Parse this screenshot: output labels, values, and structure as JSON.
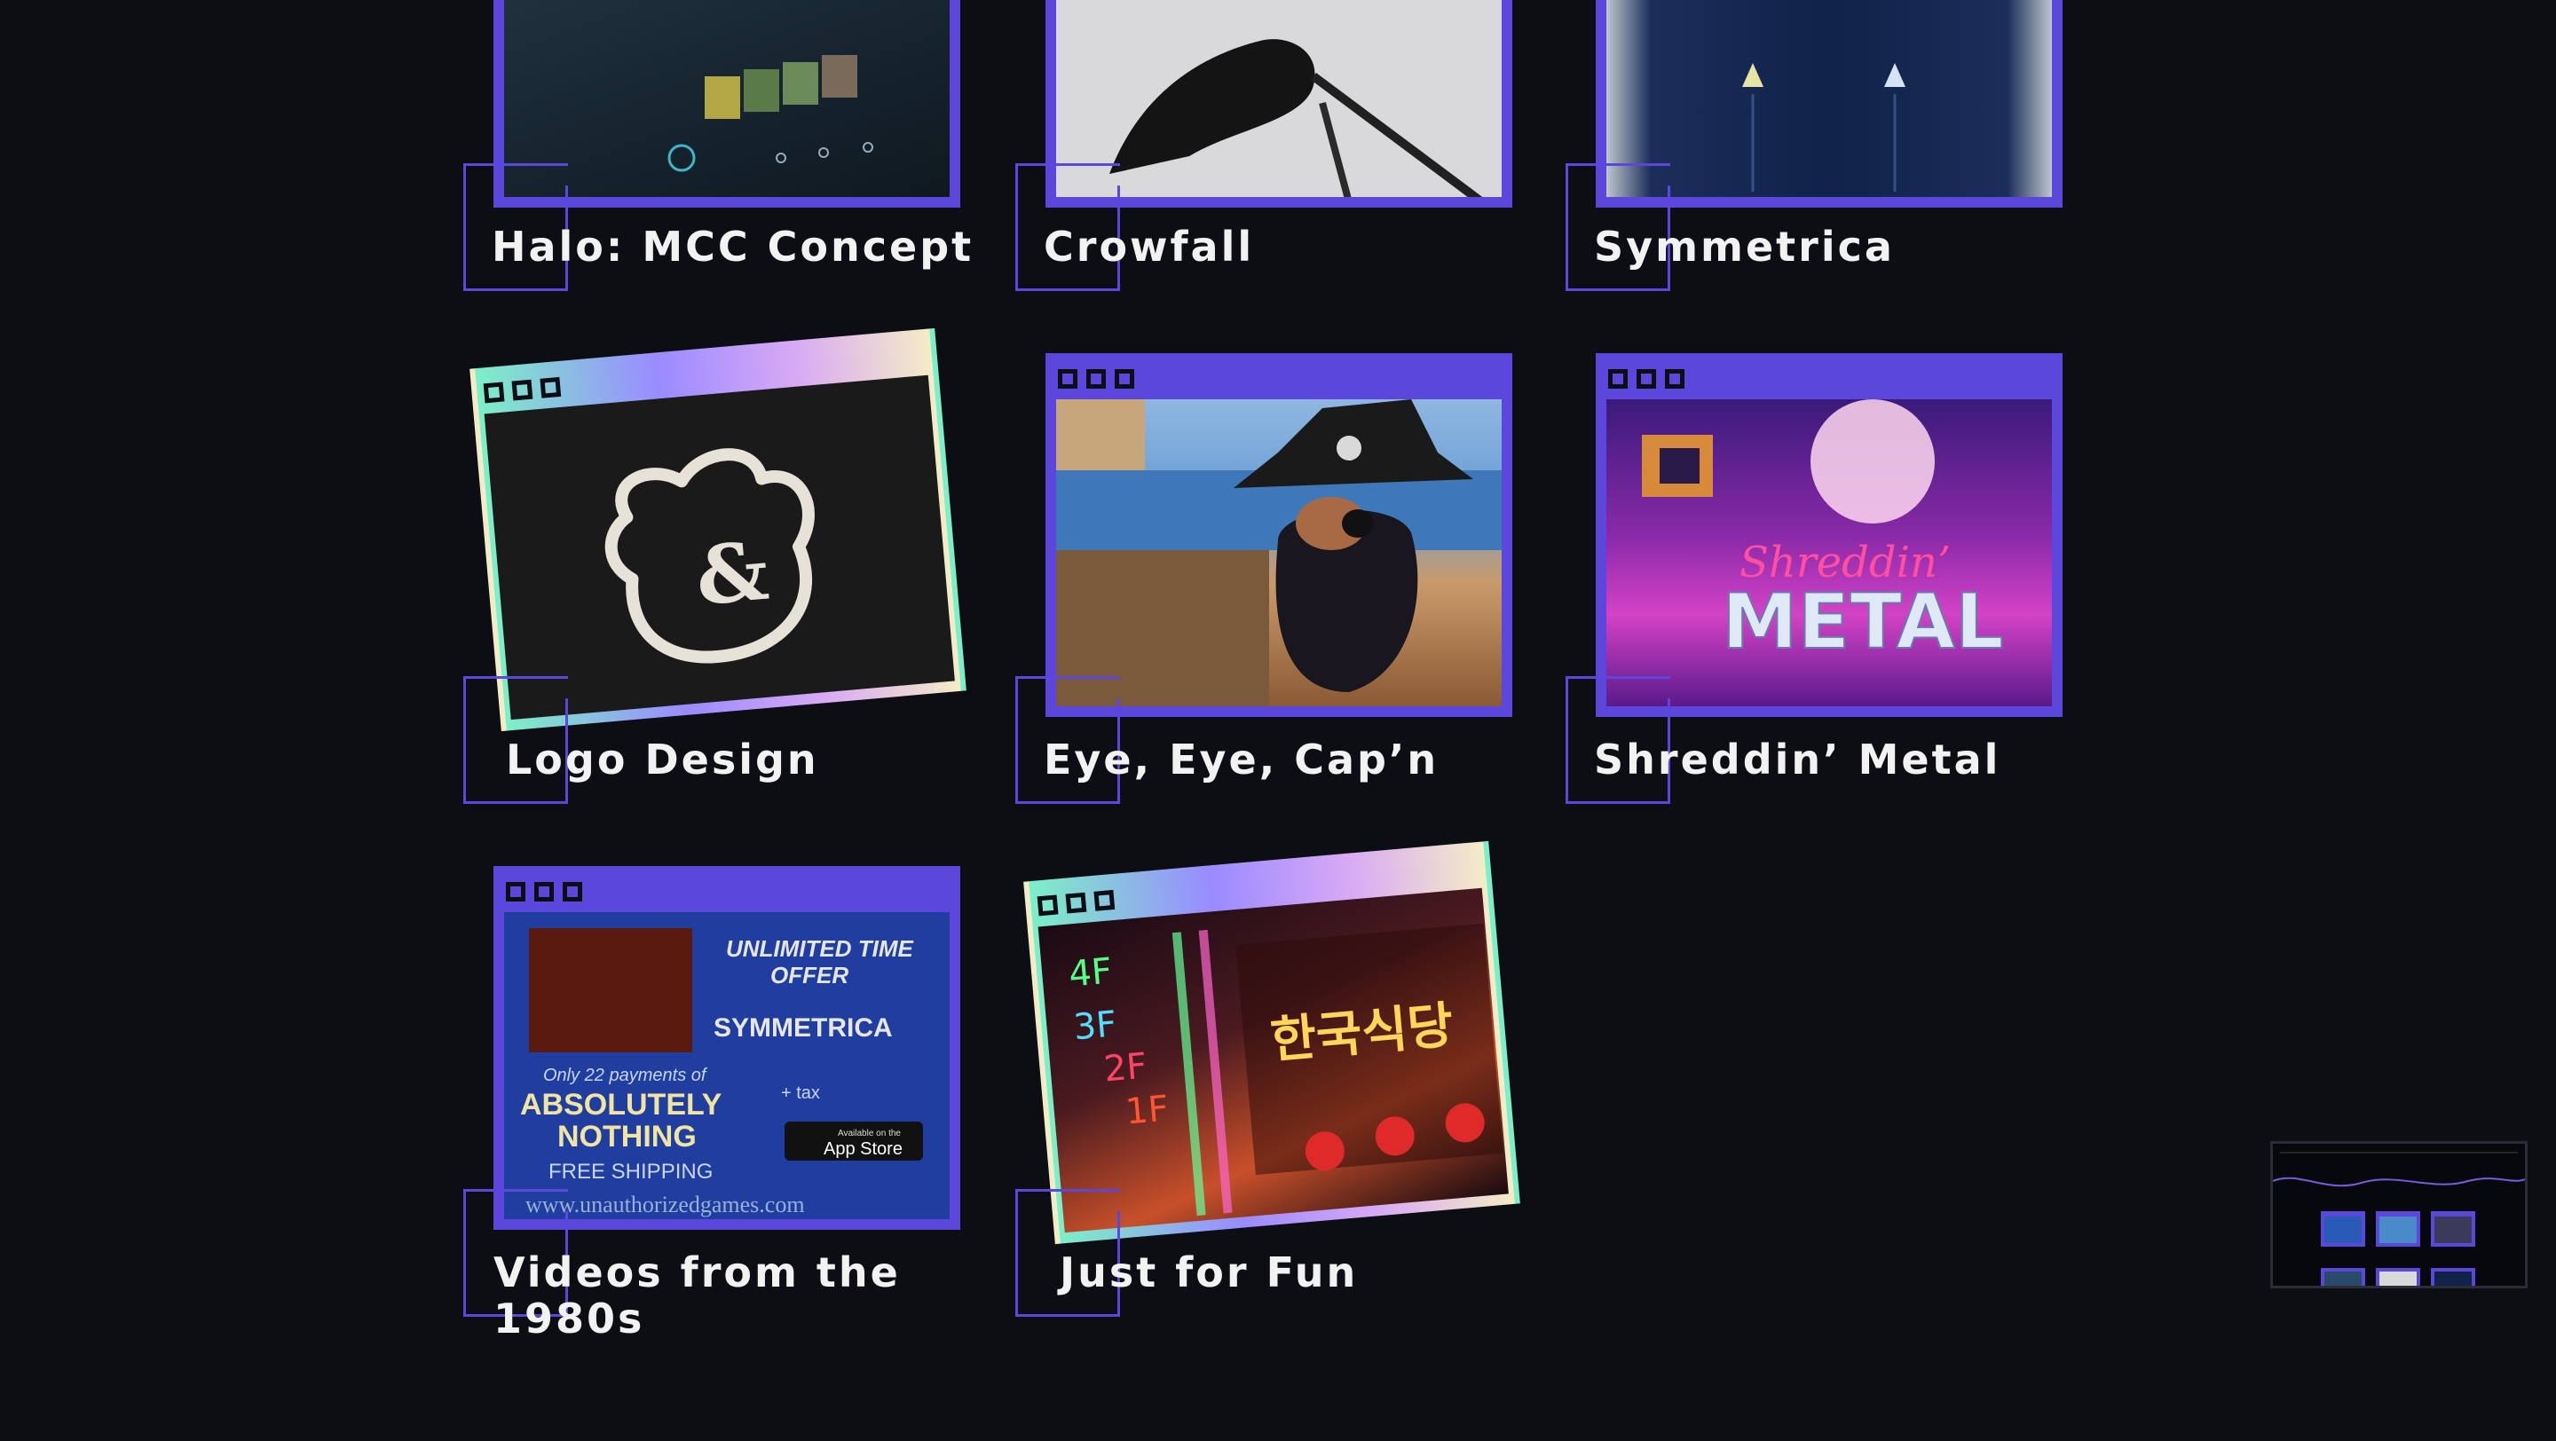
{
  "projects": [
    {
      "title": "Halo: MCC Concept"
    },
    {
      "title": "Crowfall"
    },
    {
      "title": "Symmetrica"
    },
    {
      "title": "Logo Design"
    },
    {
      "title": "Eye, Eye, Cap’n"
    },
    {
      "title": "Shreddin’ Metal"
    },
    {
      "title": "Videos from the 1980s"
    },
    {
      "title": "Just for Fun"
    }
  ],
  "thumbs": {
    "metal_text_1": "Shreddin’",
    "metal_text_2": "METAL",
    "ad_line1": "UNLIMITED TIME",
    "ad_line2": "OFFER",
    "ad_name": "SYMMETRICA",
    "ad_small": "Only 22 payments of",
    "ad_big1": "ABSOLUTELY",
    "ad_big2": "NOTHING",
    "ad_tax": "+ tax",
    "ad_ship": "FREE SHIPPING",
    "ad_store_small": "Available on the",
    "ad_store": "App Store",
    "ad_url": "www.unauthorizedgames.com",
    "neon_4f": "4F",
    "neon_3f": "3F",
    "neon_2f": "2F",
    "neon_1f": "1F",
    "neon_sign": "한국식당"
  },
  "colors": {
    "accent": "#5b47db",
    "background": "#0c0e14",
    "text": "#f2f2f2"
  }
}
